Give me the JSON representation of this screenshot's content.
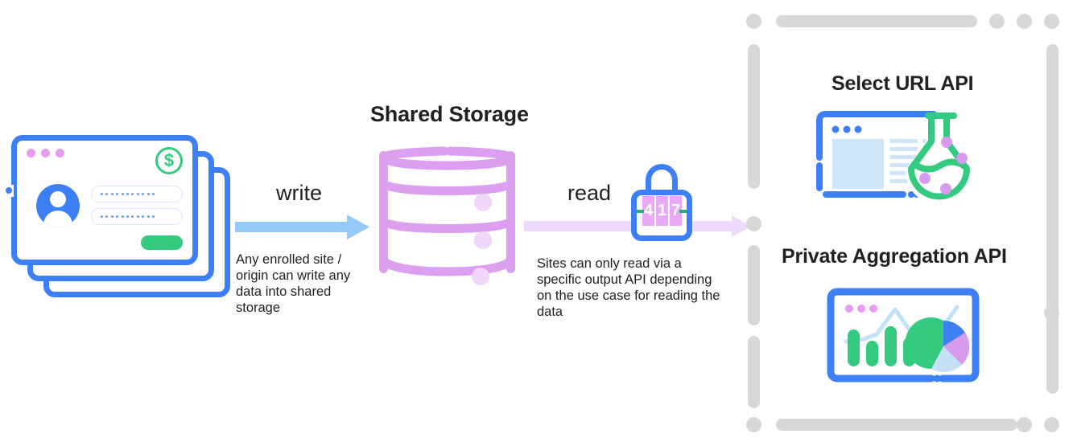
{
  "diagram": {
    "title_center": "Shared Storage",
    "left_group": {
      "name": "enrolled-sites-card-stack",
      "card_dots_colors": [
        "#e49ef0",
        "#e49ef0",
        "#e49ef0"
      ],
      "coin_symbol": "$",
      "card_count": 3
    },
    "write_flow": {
      "label": "write",
      "caption": "Any enrolled site / origin can write any data into shared storage",
      "arrow_color": "#95c9f7"
    },
    "read_flow": {
      "label": "read",
      "caption": "Sites can only read via a specific output API depending on the use case for reading the data",
      "arrow_color": "#eedafc",
      "lock": {
        "name": "combination-lock",
        "digits": [
          "4",
          "1",
          "7"
        ],
        "dial_color": "#e8a9f5",
        "body_color": "#3d7ff5",
        "dash_color": "#22b07d"
      }
    },
    "output_apis": {
      "container_name": "output-apis-panel",
      "border_color": "#d8d8d8",
      "items": [
        {
          "title": "Select URL API",
          "icon": "browser-with-flask-icon"
        },
        {
          "title": "Private Aggregation API",
          "icon": "browser-with-charts-icon"
        }
      ]
    },
    "colors": {
      "blue": "#3d7ff5",
      "light_blue": "#95c9f7",
      "pale_blue": "#cfe4f9",
      "green": "#34ca7f",
      "purple": "#dd9ff0",
      "pale_purple": "#eedafc",
      "dot_purple": "#e49ef0",
      "text": "#202124",
      "gray": "#d8d8d8"
    },
    "chart_icon": {
      "bars": [
        58,
        38,
        62,
        45
      ],
      "pie_slices": [
        {
          "value": 45,
          "color": "#34ca7f"
        },
        {
          "value": 18,
          "color": "#3d7ff5"
        },
        {
          "value": 20,
          "color": "#d79bee"
        },
        {
          "value": 17,
          "color": "#c3e2f7"
        }
      ],
      "line_points": "0,38 22,36 42,33 62,12 82,32 100,45 118,30 140,6"
    }
  }
}
